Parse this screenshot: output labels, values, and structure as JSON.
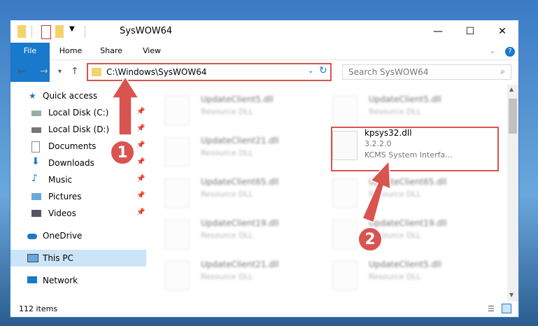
{
  "window": {
    "title": "SysWOW64",
    "minimize": "—",
    "maximize": "☐",
    "close": "✕"
  },
  "ribbon": {
    "tabs": [
      "File",
      "Home",
      "Share",
      "View"
    ]
  },
  "address": {
    "path": "C:\\Windows\\SysWOW64",
    "search_placeholder": "Search SysWOW64"
  },
  "nav": {
    "items": [
      {
        "label": "Quick access",
        "icon": "star-icon"
      },
      {
        "label": "Local Disk (C:)",
        "icon": "drive-icon"
      },
      {
        "label": "Local Disk (D:)",
        "icon": "drive-icon"
      },
      {
        "label": "Documents",
        "icon": "documents-icon"
      },
      {
        "label": "Downloads",
        "icon": "download-icon"
      },
      {
        "label": "Music",
        "icon": "music-icon"
      },
      {
        "label": "Pictures",
        "icon": "pictures-icon"
      },
      {
        "label": "Videos",
        "icon": "videos-icon"
      },
      {
        "label": "OneDrive",
        "icon": "cloud-icon"
      },
      {
        "label": "This PC",
        "icon": "computer-icon"
      },
      {
        "label": "Network",
        "icon": "network-icon"
      }
    ]
  },
  "files": {
    "left": [
      {
        "name": "UpdateClient5.dll",
        "desc": "Resource DLL"
      },
      {
        "name": "UpdateClient21.dll",
        "desc": "Resource DLL"
      },
      {
        "name": "UpdateClient65.dll",
        "desc": "Resource DLL"
      },
      {
        "name": "UpdateClient19.dll",
        "desc": "Resource DLL"
      },
      {
        "name": "UpdateClient21.dll",
        "desc": "Resource DLL"
      }
    ],
    "right": [
      {
        "name": "UpdateClient5.dll",
        "desc": "Resource DLL"
      },
      {
        "name": "kpsys32.dll",
        "version": "3.2.2.0",
        "desc": "KCMS System Interfa..."
      },
      {
        "name": "UpdateClient65.dll",
        "desc": "Resource DLL"
      },
      {
        "name": "UpdateClient19.dll",
        "desc": "Resource DLL"
      },
      {
        "name": "UpdateClient5.dll",
        "desc": "Resource DLL"
      }
    ]
  },
  "status": {
    "count": "112 items"
  },
  "callouts": [
    "1",
    "2"
  ],
  "colors": {
    "accent": "#1979ca",
    "highlight": "#d9534f"
  }
}
